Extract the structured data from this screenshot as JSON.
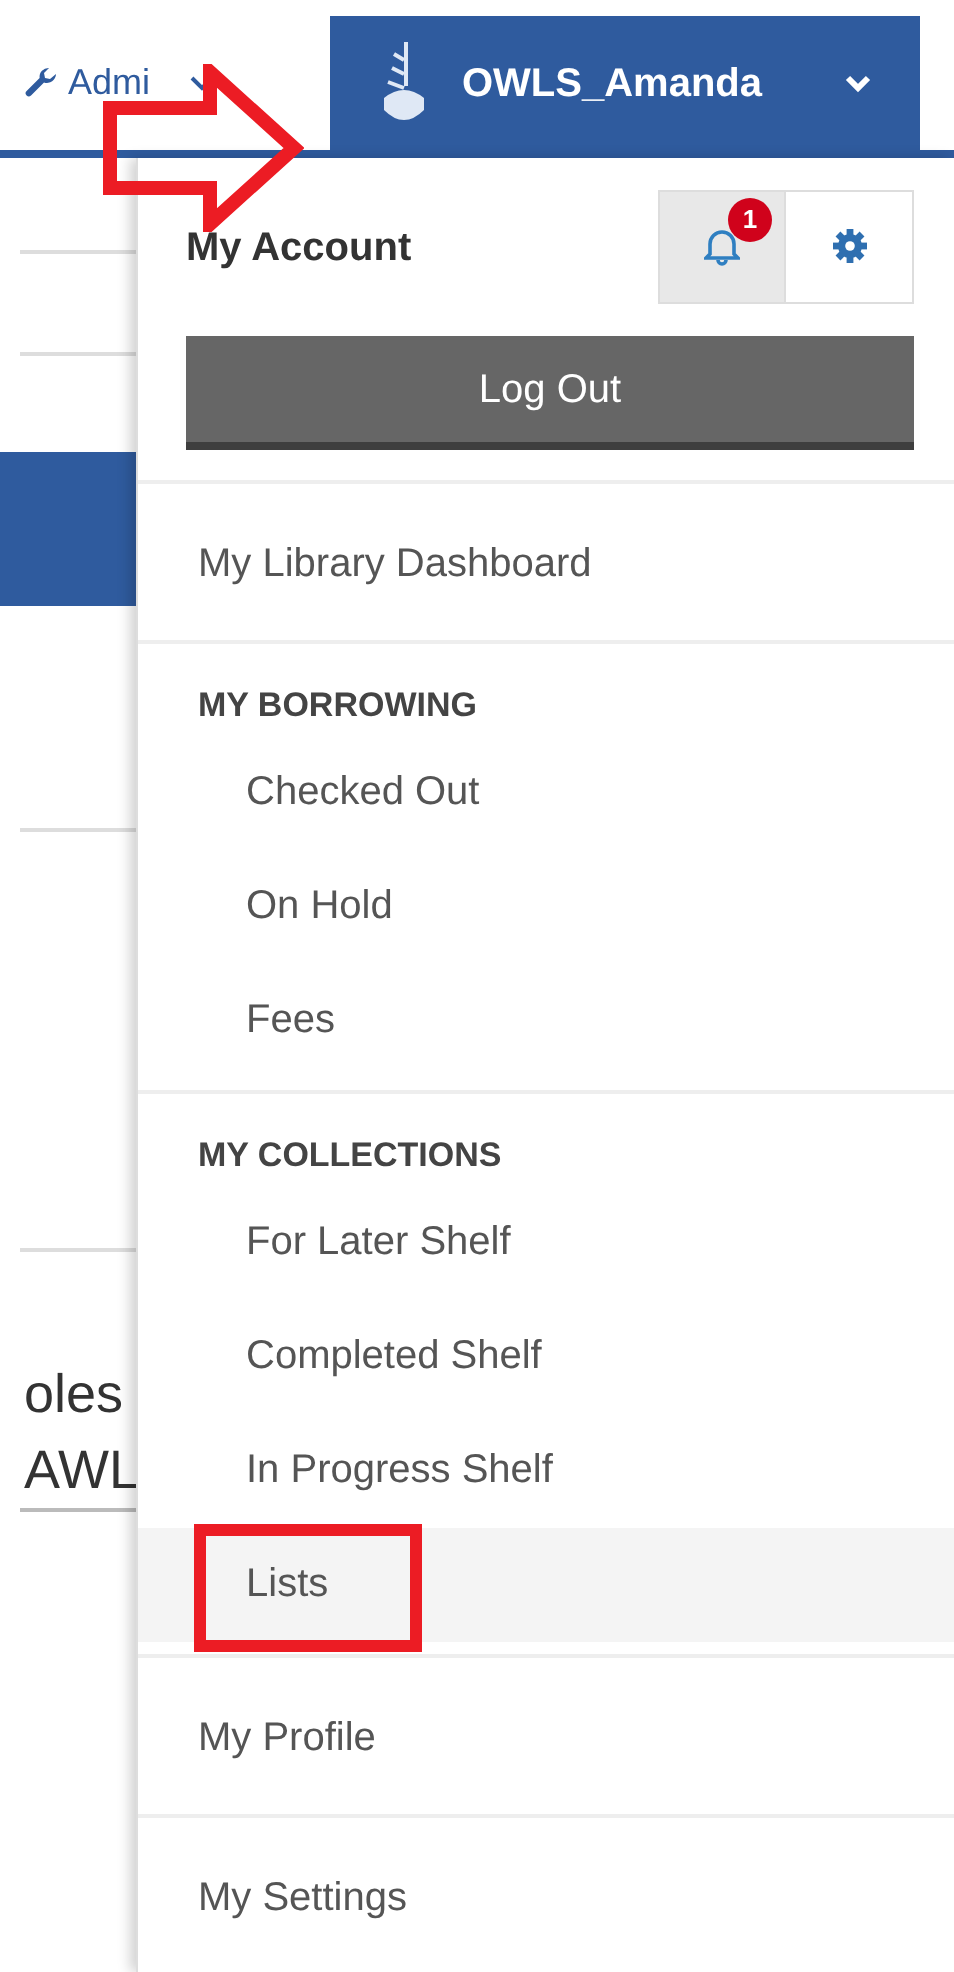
{
  "background": {
    "admin_label": "Admi",
    "fragments": [
      "oles",
      "AWL"
    ]
  },
  "account_tab": {
    "username": "OWLS_Amanda"
  },
  "menu": {
    "title": "My Account",
    "notification_badge": "1",
    "logout": "Log Out",
    "sections": [
      {
        "kind": "link",
        "label": "My Library Dashboard"
      },
      {
        "kind": "group",
        "heading": "MY BORROWING",
        "items": [
          {
            "label": "Checked Out",
            "selected": false,
            "outlined": false
          },
          {
            "label": "On Hold",
            "selected": false,
            "outlined": false
          },
          {
            "label": "Fees",
            "selected": false,
            "outlined": false
          }
        ]
      },
      {
        "kind": "group",
        "heading": "MY COLLECTIONS",
        "items": [
          {
            "label": "For Later Shelf",
            "selected": false,
            "outlined": false
          },
          {
            "label": "Completed Shelf",
            "selected": false,
            "outlined": false
          },
          {
            "label": "In Progress Shelf",
            "selected": false,
            "outlined": false
          },
          {
            "label": "Lists",
            "selected": true,
            "outlined": true
          }
        ]
      },
      {
        "kind": "link",
        "label": "My Profile"
      },
      {
        "kind": "link",
        "label": "My Settings"
      }
    ]
  }
}
